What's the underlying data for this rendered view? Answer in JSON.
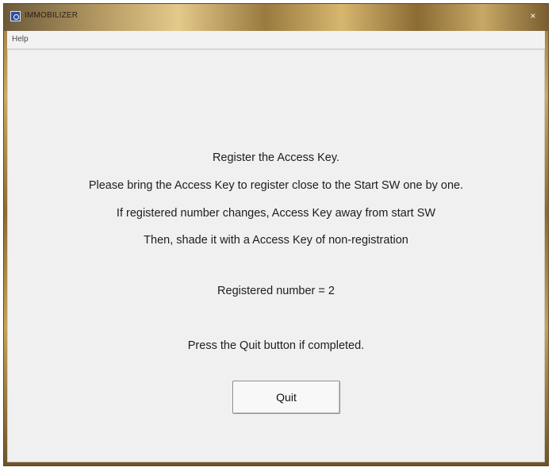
{
  "window": {
    "title": "IMMOBILIZER",
    "close_label": "×"
  },
  "menu": {
    "help_label": "Help"
  },
  "messages": {
    "line1": "Register the Access Key.",
    "line2": "Please bring the Access Key to register close to the Start SW one by one.",
    "line3": "If registered number changes, Access Key away from start SW",
    "line4": "Then, shade it with a Access Key of non-registration",
    "registered_label": "Registered number =  2",
    "instruction": "Press the Quit button if completed."
  },
  "buttons": {
    "quit_label": "Quit"
  }
}
